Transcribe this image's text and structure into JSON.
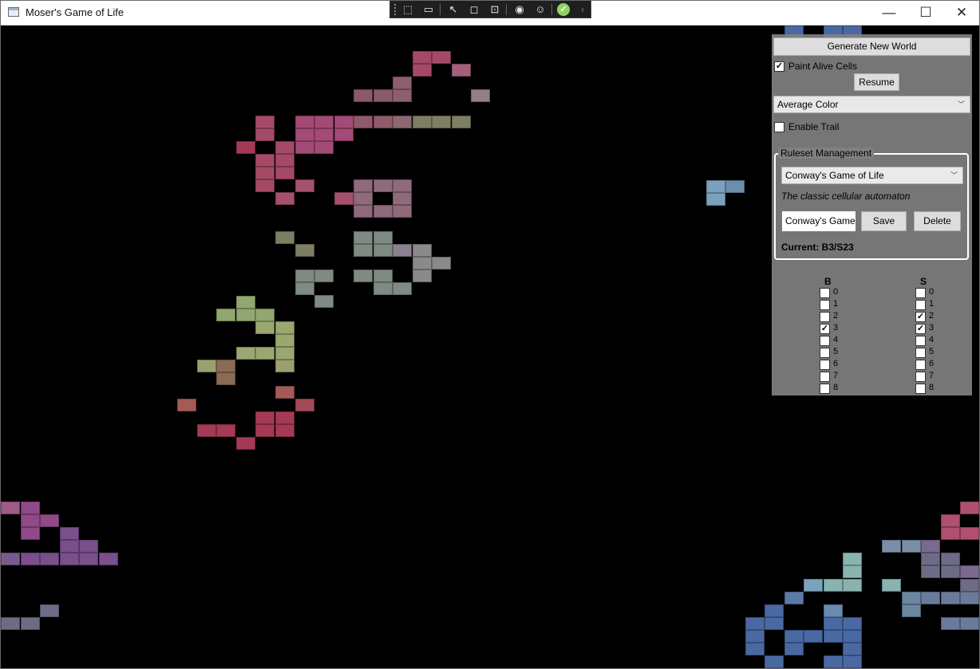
{
  "window": {
    "title": "Moser's Game of Life"
  },
  "titlebar_controls": {
    "minimize": "—",
    "maximize": "☐",
    "close": "✕"
  },
  "debug_toolbar_icons": [
    "select-element-icon",
    "record-icon",
    "pointer-icon",
    "layout-bounds-icon",
    "track-focus-icon",
    "hot-reload-icon",
    "accessibility-icon",
    "ok-status-icon",
    "collapse-icon"
  ],
  "panel": {
    "generate_label": "Generate New World",
    "paint_alive_label": "Paint Alive Cells",
    "paint_alive_checked": true,
    "resume_label": "Resume",
    "color_mode": "Average Color",
    "enable_trail_label": "Enable Trail",
    "enable_trail_checked": false,
    "ruleset": {
      "group_title": "Ruleset Management",
      "selected": "Conway's Game of Life",
      "description": "The classic cellular automaton",
      "name_value": "Conway's Game",
      "save_label": "Save",
      "delete_label": "Delete",
      "current_label": "Current: B3/S23"
    },
    "birth": {
      "header": "B",
      "numbers": [
        "0",
        "1",
        "2",
        "3",
        "4",
        "5",
        "6",
        "7",
        "8"
      ],
      "checked": [
        3
      ]
    },
    "survival": {
      "header": "S",
      "numbers": [
        "0",
        "1",
        "2",
        "3",
        "4",
        "5",
        "6",
        "7",
        "8"
      ],
      "checked": [
        2,
        3
      ]
    }
  },
  "cell_color_groups": {
    "magenta": "#a44a66",
    "rose": "#8f4f63",
    "olive": "#7e7e63",
    "gray": "#7e8a82",
    "green": "#90a870",
    "brown": "#8c6b55",
    "purple": "#7a4f8c",
    "slate": "#6c6c86",
    "blue": "#4a69a3",
    "teal": "#8ab3b0",
    "pink": "#b08a9a"
  }
}
